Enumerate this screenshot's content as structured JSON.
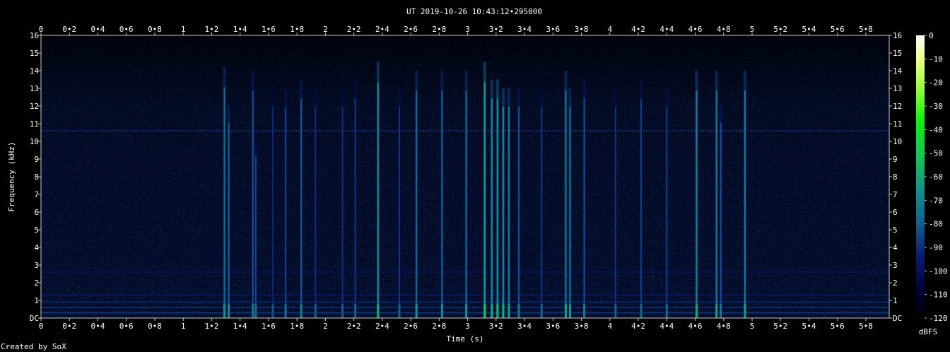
{
  "chart_data": {
    "type": "heatmap",
    "title": "UT 2019-10-26 10:43:12•295000",
    "xlabel": "Time (s)",
    "ylabel": "Frequency (kHz)",
    "xlim": [
      0,
      5.96
    ],
    "ylim": [
      0,
      16
    ],
    "x_ticks": [
      "0",
      "0•2",
      "0•4",
      "0•6",
      "0•8",
      "1",
      "1•2",
      "1•4",
      "1•6",
      "1•8",
      "2",
      "2•2",
      "2•4",
      "2•6",
      "2•8",
      "3",
      "3•2",
      "3•4",
      "3•6",
      "3•8",
      "4",
      "4•2",
      "4•4",
      "4•6",
      "4•8",
      "5",
      "5•2",
      "5•4",
      "5•6",
      "5•8"
    ],
    "y_ticks": [
      "DC",
      "1",
      "2",
      "3",
      "4",
      "5",
      "6",
      "7",
      "8",
      "9",
      "10",
      "11",
      "12",
      "13",
      "14",
      "15",
      "16"
    ],
    "colorbar": {
      "label": "dBFS",
      "ticks": [
        "0",
        "-10",
        "-20",
        "-30",
        "-40",
        "-50",
        "-60",
        "-70",
        "-80",
        "-90",
        "-100",
        "-110",
        "-120"
      ],
      "range": [
        -120,
        0
      ]
    },
    "background_level_dbfs": -110,
    "continuous_tone": {
      "freq_khz": 10.6,
      "level_dbfs": -90
    },
    "low_freq_bands_khz": [
      {
        "freq": 0.3,
        "level_dbfs": -85
      },
      {
        "freq": 0.6,
        "level_dbfs": -88
      },
      {
        "freq": 0.9,
        "level_dbfs": -90
      },
      {
        "freq": 1.3,
        "level_dbfs": -95
      },
      {
        "freq": 2.6,
        "level_dbfs": -98
      }
    ],
    "transients": [
      {
        "t": 1.29,
        "fmax": 14.2,
        "level_dbfs": -75
      },
      {
        "t": 1.32,
        "fmax": 12.0,
        "level_dbfs": -78
      },
      {
        "t": 1.49,
        "fmax": 14.0,
        "level_dbfs": -82
      },
      {
        "t": 1.51,
        "fmax": 10.0,
        "level_dbfs": -85
      },
      {
        "t": 1.63,
        "fmax": 13.0,
        "level_dbfs": -92
      },
      {
        "t": 1.72,
        "fmax": 13.0,
        "level_dbfs": -85
      },
      {
        "t": 1.83,
        "fmax": 13.5,
        "level_dbfs": -80
      },
      {
        "t": 1.93,
        "fmax": 13.0,
        "level_dbfs": -90
      },
      {
        "t": 2.12,
        "fmax": 13.0,
        "level_dbfs": -90
      },
      {
        "t": 2.21,
        "fmax": 13.5,
        "level_dbfs": -88
      },
      {
        "t": 2.37,
        "fmax": 14.5,
        "level_dbfs": -68
      },
      {
        "t": 2.52,
        "fmax": 13.0,
        "level_dbfs": -88
      },
      {
        "t": 2.64,
        "fmax": 14.0,
        "level_dbfs": -76
      },
      {
        "t": 2.82,
        "fmax": 14.0,
        "level_dbfs": -78
      },
      {
        "t": 2.99,
        "fmax": 14.0,
        "level_dbfs": -76
      },
      {
        "t": 3.12,
        "fmax": 14.5,
        "level_dbfs": -62
      },
      {
        "t": 3.17,
        "fmax": 13.5,
        "level_dbfs": -68
      },
      {
        "t": 3.21,
        "fmax": 13.5,
        "level_dbfs": -66
      },
      {
        "t": 3.25,
        "fmax": 13.0,
        "level_dbfs": -68
      },
      {
        "t": 3.29,
        "fmax": 13.0,
        "level_dbfs": -72
      },
      {
        "t": 3.36,
        "fmax": 13.0,
        "level_dbfs": -82
      },
      {
        "t": 3.52,
        "fmax": 13.0,
        "level_dbfs": -88
      },
      {
        "t": 3.69,
        "fmax": 14.0,
        "level_dbfs": -72
      },
      {
        "t": 3.72,
        "fmax": 13.0,
        "level_dbfs": -74
      },
      {
        "t": 3.82,
        "fmax": 13.5,
        "level_dbfs": -82
      },
      {
        "t": 4.04,
        "fmax": 13.0,
        "level_dbfs": -88
      },
      {
        "t": 4.22,
        "fmax": 13.5,
        "level_dbfs": -86
      },
      {
        "t": 4.4,
        "fmax": 13.0,
        "level_dbfs": -86
      },
      {
        "t": 4.61,
        "fmax": 14.0,
        "level_dbfs": -70
      },
      {
        "t": 4.75,
        "fmax": 14.0,
        "level_dbfs": -72
      },
      {
        "t": 4.78,
        "fmax": 12.0,
        "level_dbfs": -82
      },
      {
        "t": 4.95,
        "fmax": 14.0,
        "level_dbfs": -72
      }
    ],
    "footer": "Created by SoX"
  }
}
